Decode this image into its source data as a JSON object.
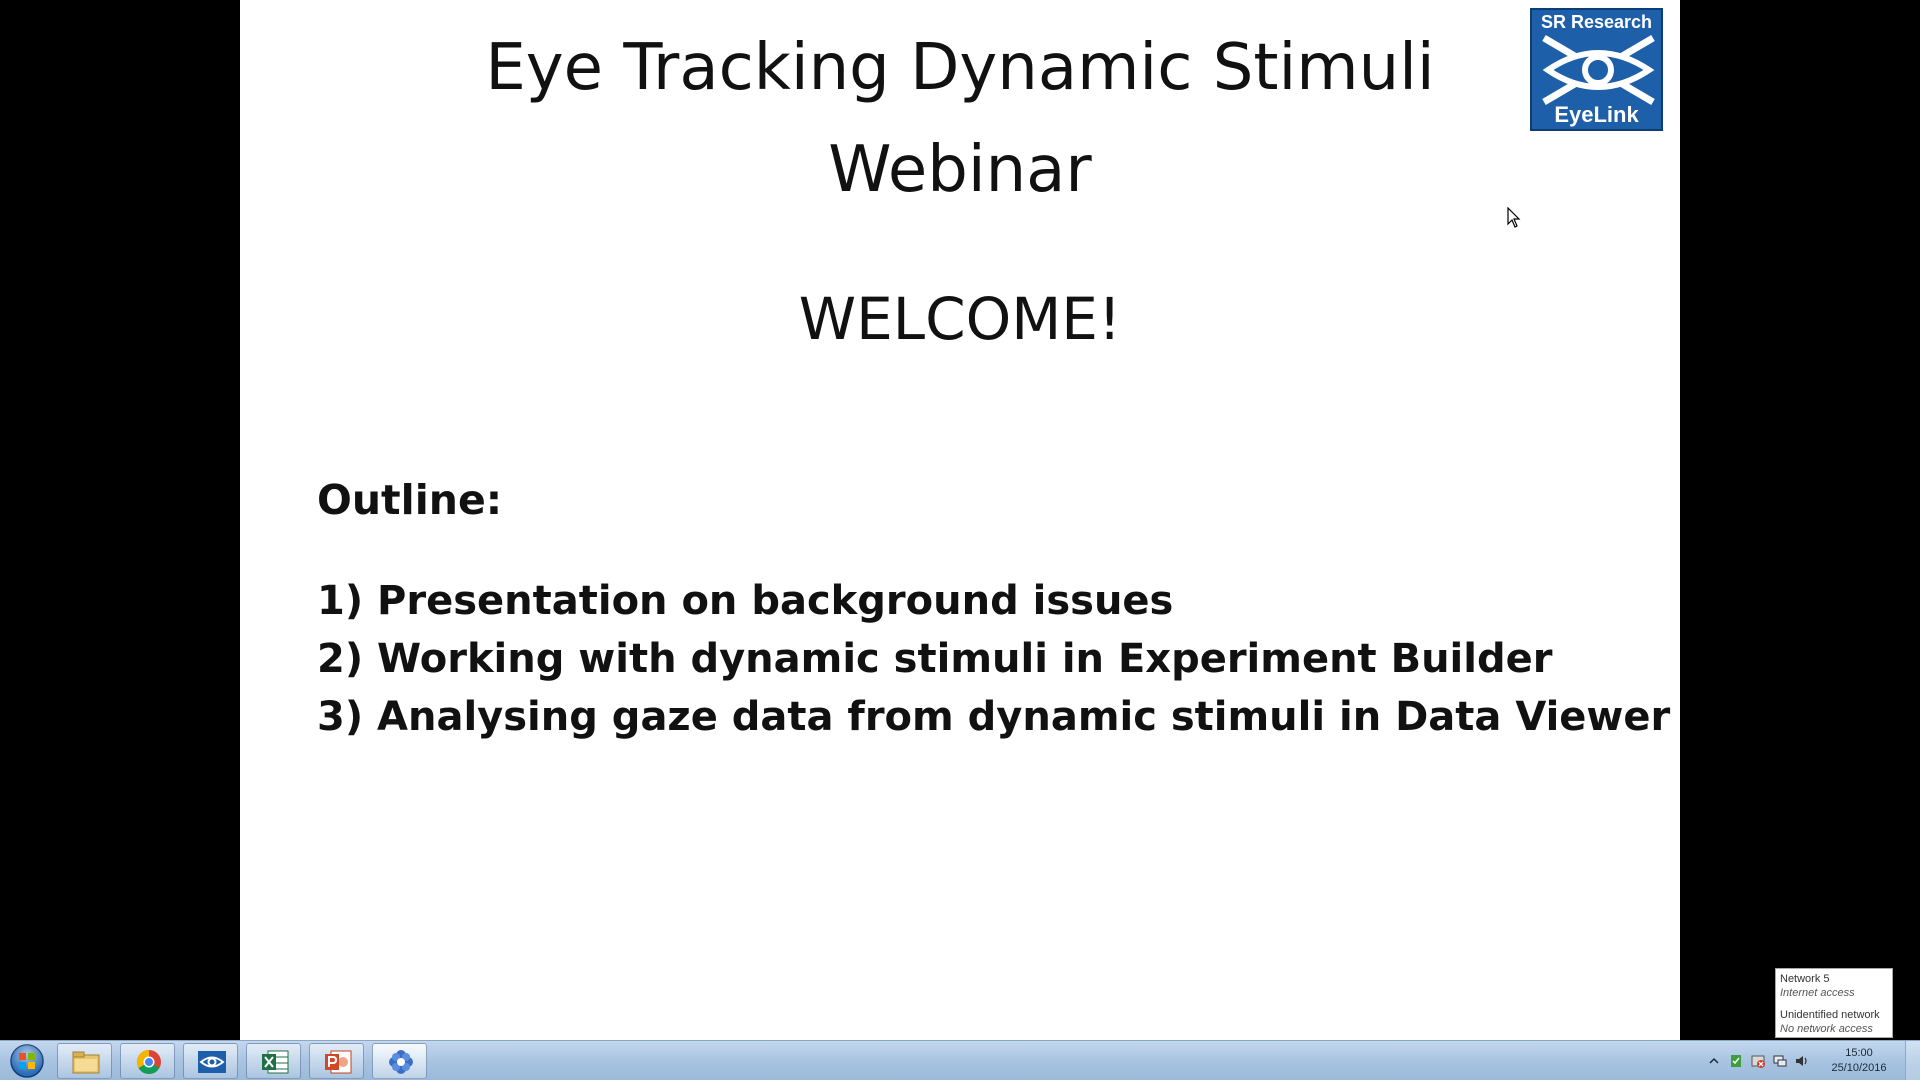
{
  "slide": {
    "title_line1": "Eye Tracking Dynamic Stimuli",
    "title_line2": "Webinar",
    "welcome": "WELCOME!",
    "outline_heading": "Outline:",
    "outline_items": [
      "1) Presentation on background issues",
      "2) Working with dynamic stimuli in Experiment Builder",
      "3) Analysing gaze data from dynamic stimuli in Data Viewer"
    ],
    "logo": {
      "top_text": "SR Research",
      "bottom_text": "EyeLink",
      "color": "#1d5fa8"
    }
  },
  "network_popup": {
    "network_name": "Network  5",
    "network_status": "Internet access",
    "other_name": "Unidentified network",
    "other_status": "No network access"
  },
  "taskbar": {
    "apps": [
      {
        "name": "file-explorer-icon"
      },
      {
        "name": "chrome-icon"
      },
      {
        "name": "eyelink-app-icon"
      },
      {
        "name": "excel-icon"
      },
      {
        "name": "powerpoint-icon"
      },
      {
        "name": "flower-app-icon"
      }
    ],
    "clock_time": "15:00",
    "clock_date": "25/10/2016"
  }
}
